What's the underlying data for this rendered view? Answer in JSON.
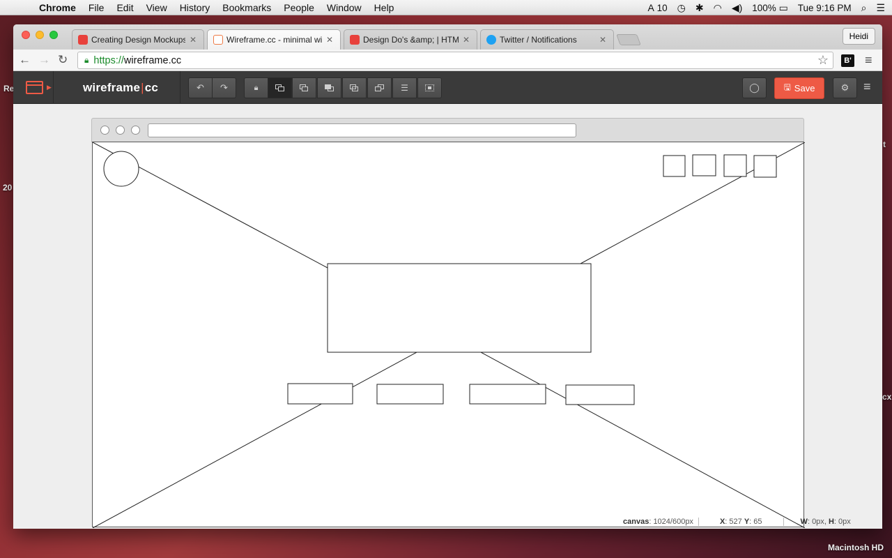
{
  "menubar": {
    "app": "Chrome",
    "items": [
      "File",
      "Edit",
      "View",
      "History",
      "Bookmarks",
      "People",
      "Window",
      "Help"
    ],
    "adobe_count": "10",
    "battery": "100%",
    "clock": "Tue 9:16 PM"
  },
  "desktop": {
    "left_fragment_1": "Re",
    "left_fragment_2": "20",
    "right_fragment_1": "t",
    "right_fragment_2": "cx",
    "drive_label": "Macintosh HD"
  },
  "browser": {
    "tabs": [
      {
        "title": "Creating Design Mockups |",
        "favicon_color": "#e8413c",
        "active": false
      },
      {
        "title": "Wireframe.cc - minimal wir",
        "favicon_color": "#ee7a45",
        "active": true
      },
      {
        "title": "Design Do's &amp; | HTML",
        "favicon_color": "#e8413c",
        "active": false
      },
      {
        "title": "Twitter / Notifications",
        "favicon_color": "#1da1f2",
        "active": false
      }
    ],
    "profile": "Heidi",
    "url_scheme": "https://",
    "url_host": "wireframe.cc",
    "extension_label": "B'"
  },
  "app": {
    "name_left": "wireframe",
    "name_sep": "|",
    "name_right": "cc",
    "save_label": "Save",
    "accent_color": "#ee5a45",
    "toolbar_icons": [
      "undo-icon",
      "redo-icon",
      "lock-icon",
      "send-to-back-icon",
      "bring-backward-icon",
      "bring-forward-icon",
      "bring-to-front-icon",
      "move-to-top-icon",
      "align-left-icon",
      "group-icon"
    ]
  },
  "status": {
    "canvas_label": "canvas",
    "canvas_value": "1024/600px",
    "x_label": "X",
    "x_value": "527",
    "y_label": "Y",
    "y_value": "65",
    "w_label": "W",
    "w_value": "0px",
    "h_label": "H",
    "h_value": "0px"
  }
}
